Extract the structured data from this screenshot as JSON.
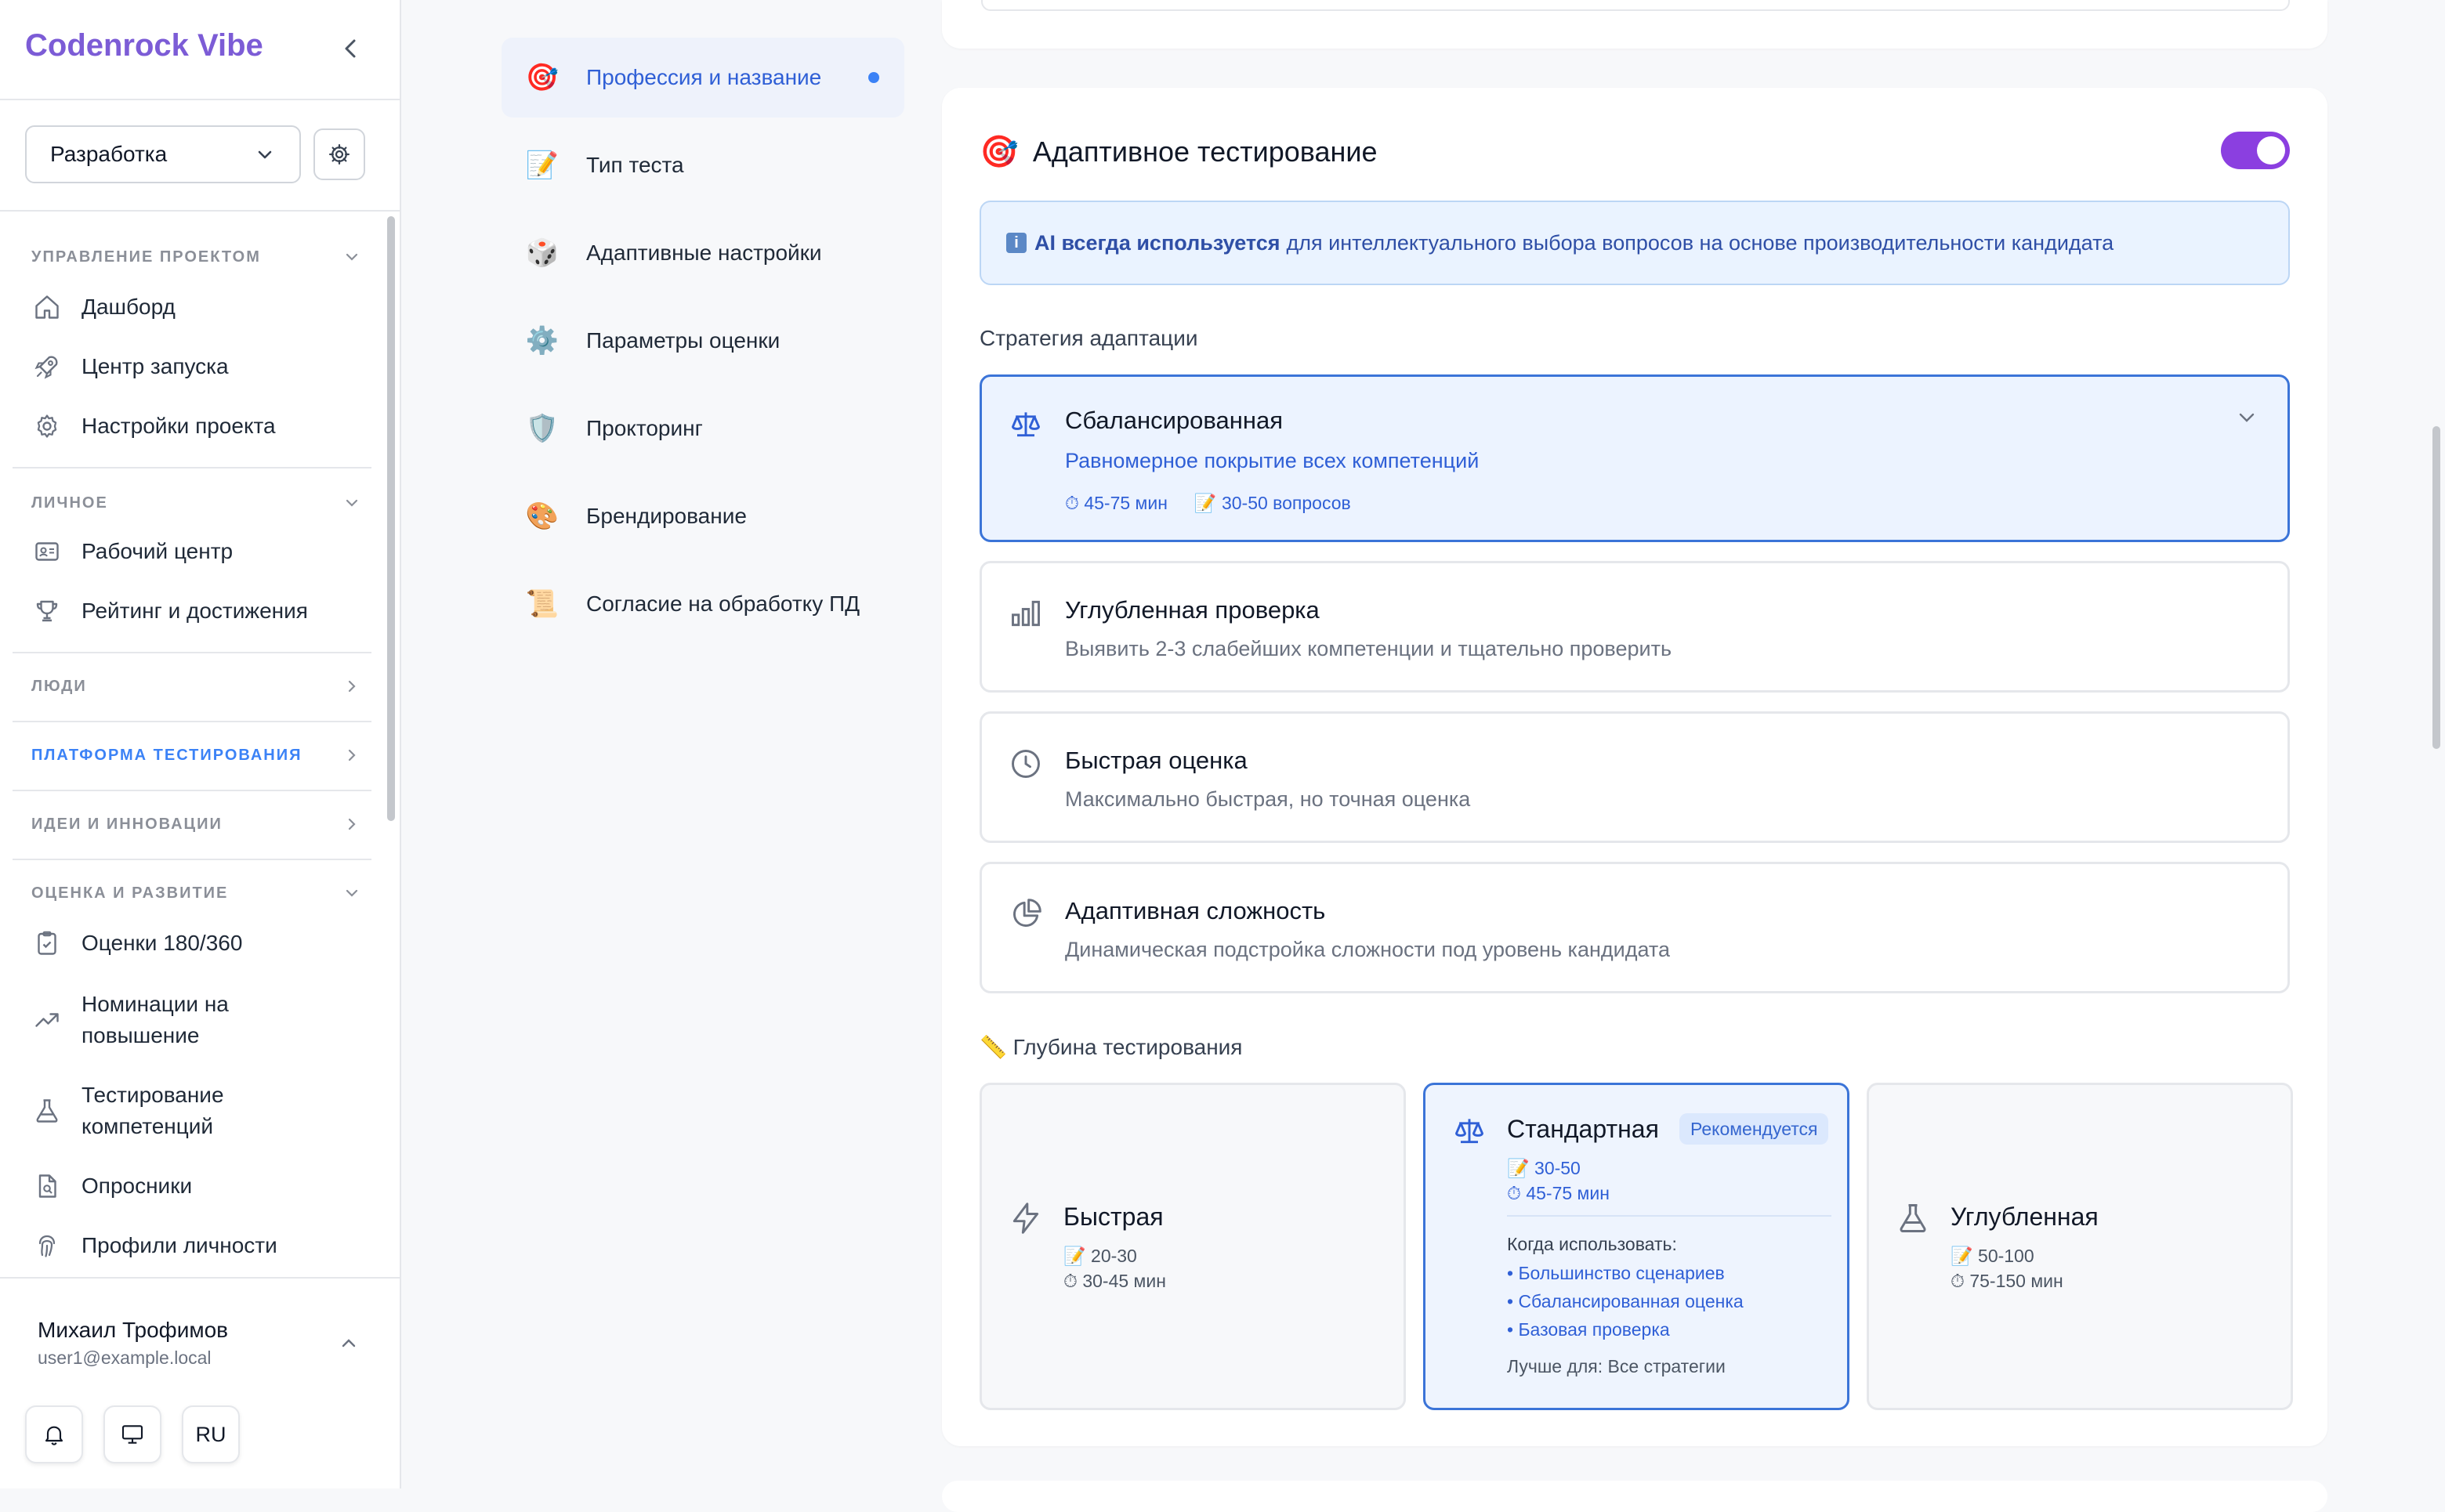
{
  "sidebar": {
    "brand": "Codenrock Vibe",
    "project_select": "Разработка",
    "sections": [
      {
        "title": "УПРАВЛЕНИЕ ПРОЕКТОМ",
        "items": [
          "Дашборд",
          "Центр запуска",
          "Настройки проекта"
        ]
      },
      {
        "title": "ЛИЧНОЕ",
        "items": [
          "Рабочий центр",
          "Рейтинг и достижения"
        ]
      },
      {
        "title": "ЛЮДИ"
      },
      {
        "title": "ПЛАТФОРМА ТЕСТИРОВАНИЯ"
      },
      {
        "title": "ИДЕИ И ИННОВАЦИИ"
      },
      {
        "title": "ОЦЕНКА И РАЗВИТИЕ",
        "items": [
          "Оценки 180/360",
          "Номинации на повышение",
          "Тестирование компетенций",
          "Опросники",
          "Профили личности"
        ]
      }
    ],
    "user": {
      "name": "Михаил Трофимов",
      "email": "user1@example.local"
    },
    "lang": "RU"
  },
  "settings_nav": [
    {
      "icon": "🎯",
      "label": "Профессия и название"
    },
    {
      "icon": "📝",
      "label": "Тип теста"
    },
    {
      "icon": "🎲",
      "label": "Адаптивные настройки"
    },
    {
      "icon": "⚙️",
      "label": "Параметры оценки"
    },
    {
      "icon": "🛡️",
      "label": "Прокторинг"
    },
    {
      "icon": "🎨",
      "label": "Брендирование"
    },
    {
      "icon": "📜",
      "label": "Согласие на обработку ПД"
    }
  ],
  "adaptive": {
    "icon": "🎯",
    "title": "Адаптивное тестирование",
    "enabled": true,
    "info_badge": "i",
    "info_bold": "AI всегда используется",
    "info_rest": "для интеллектуального выбора вопросов на основе производительности кандидата",
    "strategy_label": "Стратегия адаптации",
    "strategies": [
      {
        "title": "Сбалансированная",
        "desc": "Равномерное покрытие всех компетенций",
        "time": "⏱ 45-75 мин",
        "questions": "📝 30-50 вопросов"
      },
      {
        "title": "Углубленная проверка",
        "desc": "Выявить 2-3 слабейших компетенции и тщательно проверить"
      },
      {
        "title": "Быстрая оценка",
        "desc": "Максимально быстрая, но точная оценка"
      },
      {
        "title": "Адаптивная сложность",
        "desc": "Динамическая подстройка сложности под уровень кандидата"
      }
    ],
    "depth_label": "📏 Глубина тестирования",
    "depths": [
      {
        "title": "Быстрая",
        "questions": "📝 20-30",
        "time": "⏱ 30-45 мин"
      },
      {
        "title": "Стандартная",
        "badge": "Рекомендуется",
        "questions": "📝 30-50",
        "time": "⏱ 45-75 мин",
        "when_label": "Когда использовать:",
        "bullets": [
          "• Большинство сценариев",
          "• Сбалансированная оценка",
          "• Базовая проверка"
        ],
        "best_for": "Лучше для: Все стратегии"
      },
      {
        "title": "Углубленная",
        "questions": "📝 50-100",
        "time": "⏱ 75-150 мин"
      }
    ]
  },
  "colors": {
    "accent": "#3b74d8",
    "brand": "#7c5cd6",
    "toggle": "#8b3fe0"
  }
}
